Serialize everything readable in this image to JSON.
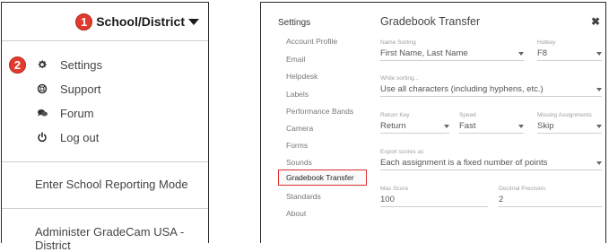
{
  "left_panel": {
    "header": {
      "badge": "1",
      "label": "School/District"
    },
    "settings_badge": "2",
    "menu": [
      {
        "label": "Settings",
        "icon": "gear-icon"
      },
      {
        "label": "Support",
        "icon": "lifebuoy-icon"
      },
      {
        "label": "Forum",
        "icon": "chat-bubbles-icon"
      },
      {
        "label": "Log out",
        "icon": "power-icon"
      }
    ],
    "school_reporting": "Enter School Reporting Mode",
    "administer": "Administer GradeCam USA - District"
  },
  "dialog": {
    "sidebar_title": "Settings",
    "sidebar_items": [
      "Account Profile",
      "Email",
      "Helpdesk",
      "Labels",
      "Performance Bands",
      "Camera",
      "Forms",
      "Sounds",
      "Gradebook Transfer",
      "Standards",
      "About"
    ],
    "active_item": "Gradebook Transfer",
    "title": "Gradebook Transfer",
    "close_glyph": "✖",
    "fields": {
      "name_sorting": {
        "label": "Name Sorting",
        "value": "First Name, Last Name"
      },
      "hotkey": {
        "label": "Hotkey",
        "value": "F8"
      },
      "while_sorting": {
        "label": "While sorting...",
        "value": "Use all characters (including hyphens, etc.)"
      },
      "return_key": {
        "label": "Return Key",
        "value": "Return"
      },
      "speed": {
        "label": "Speed",
        "value": "Fast"
      },
      "missing_assignments": {
        "label": "Missing Assignments",
        "value": "Skip"
      },
      "export_scores": {
        "label": "Export scores as",
        "value": "Each assignment is a fixed number of points"
      },
      "max_score": {
        "label": "Max Score",
        "value": "100"
      },
      "decimal_precision": {
        "label": "Decimal Precision",
        "value": "2"
      }
    }
  },
  "colors": {
    "badge": "#e23b2e",
    "highlight_border": "#d93030"
  }
}
